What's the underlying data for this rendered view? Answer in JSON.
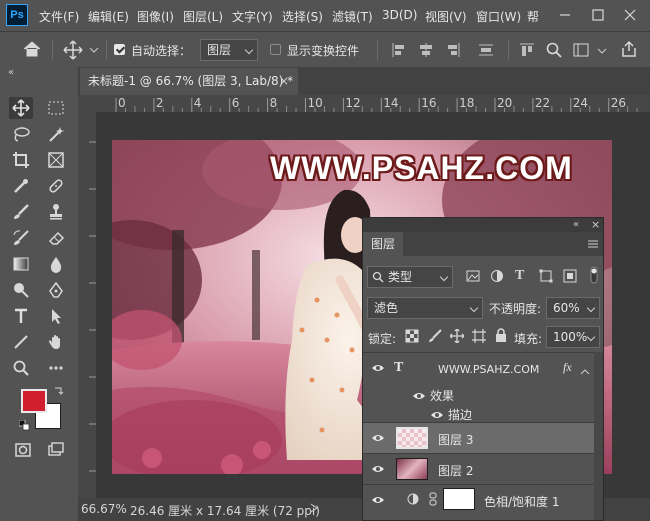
{
  "app": {
    "logo": "Ps"
  },
  "menu": [
    "文件(F)",
    "编辑(E)",
    "图像(I)",
    "图层(L)",
    "文字(Y)",
    "选择(S)",
    "滤镜(T)",
    "3D(D)",
    "视图(V)",
    "窗口(W)",
    "帮"
  ],
  "options": {
    "auto_select_label": "自动选择：",
    "auto_select_value": "图层",
    "show_transform_label": "显示变换控件"
  },
  "document": {
    "tab_title": "未标题-1 @ 66.7% (图层 3, Lab/8) *",
    "close_glyph": "×"
  },
  "ruler": {
    "h_ticks": [
      "0",
      "2",
      "4",
      "6",
      "8",
      "10",
      "12",
      "14",
      "16",
      "18",
      "20",
      "22",
      "24",
      "26"
    ]
  },
  "canvas": {
    "watermark": "WWW.PSAHZ.COM"
  },
  "status": {
    "zoom": "66.67%",
    "doc_info": "26.46 厘米 x 17.64 厘米 (72 ppi)"
  },
  "colors": {
    "foreground": "#d11f30",
    "background": "#ffffff",
    "accent": "#31a8ff"
  },
  "layers_panel": {
    "tab": "图层",
    "filter_kind": "类型",
    "blend_mode": "滤色",
    "opacity_label": "不透明度:",
    "opacity_value": "60%",
    "lock_label": "锁定:",
    "fill_label": "填充:",
    "fill_value": "100%",
    "layers": [
      {
        "name": "WWW.PSAHZ.COM",
        "type": "text",
        "fx": "fx"
      },
      {
        "name": "效果",
        "type": "effects"
      },
      {
        "name": "描边",
        "type": "effect"
      },
      {
        "name": "图层 3",
        "type": "pixel",
        "selected": true
      },
      {
        "name": "图层 2",
        "type": "pixel"
      },
      {
        "name": "色相/饱和度 1",
        "type": "adjustment"
      }
    ]
  }
}
